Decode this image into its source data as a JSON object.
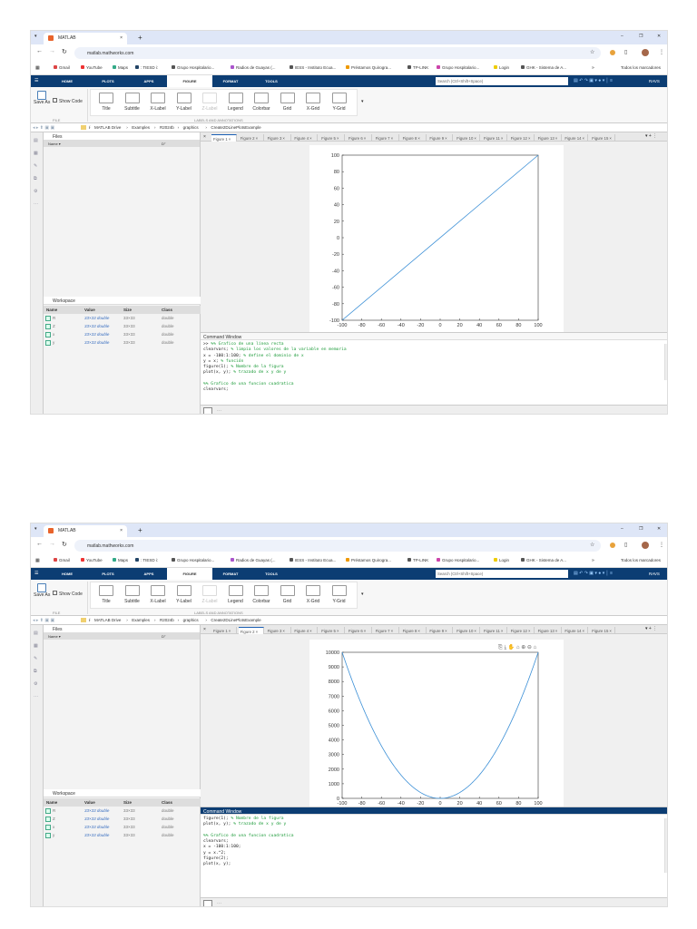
{
  "app": {
    "browser_tab": "MATLAB",
    "url": "matlab.mathworks.com",
    "bookmarks": [
      "Gmail",
      "YouTube",
      "Maps",
      ": TIESD i:",
      "Grupo Hospitalario...",
      "Radios de Guayas (...",
      "IESS - Instituto Ecua...",
      "Préstamos Quirogra...",
      "TP-LINK",
      "Grupo Hospitalario...",
      "Login",
      "GHK - Sistema de A..."
    ],
    "bookmarks_more": "»",
    "all_bookmarks": "Todos los marcadores",
    "toolstrip_tabs": [
      "HOME",
      "PLOTS",
      "APPS",
      "FIGURE",
      "FORMAT",
      "TOOLS"
    ],
    "search_placeholder": "Search (Ctrl+Shift+Space)",
    "user": "RAVS",
    "ribbon": {
      "save_as": "Save As",
      "show_code": "Show Code",
      "file_group": "FILE",
      "buttons": [
        "Title",
        "Subtitle",
        "X-Label",
        "Y-Label",
        "Z-Label",
        "Legend",
        "Colorbar",
        "Grid",
        "X-Grid",
        "Y-Grid"
      ],
      "labels_group": "LABELS AND ANNOTATIONS"
    },
    "path": [
      "/",
      "MATLAB Drive",
      "Examples",
      "R2024b",
      "graphics",
      "Create2DLinePlotsExample"
    ],
    "files": {
      "title": "Files",
      "col_name": "Name ▾",
      "col_date": "D°"
    },
    "workspace": {
      "title": "Workspace",
      "cols": [
        "Name",
        "Value",
        "Size",
        "Class"
      ],
      "rows": [
        [
          "R",
          "33×33 double",
          "33×33",
          "double"
        ],
        [
          "Z",
          "33×33 double",
          "33×33",
          "double"
        ],
        [
          "x",
          "33×33 double",
          "33×33",
          "double"
        ],
        [
          "y",
          "33×33 double",
          "33×33",
          "double"
        ]
      ]
    },
    "figure_tabs": [
      "Figure 1",
      "Figure 2",
      "Figure 3",
      "Figure 4",
      "Figure 5",
      "Figure 6",
      "Figure 7",
      "Figure 8",
      "Figure 9",
      "Figure 10",
      "Figure 11",
      "Figure 12",
      "Figure 13",
      "Figure 14",
      "Figure 15"
    ],
    "command_window": "Command Window",
    "prompt_more": "···",
    "colors": {
      "toolstrip": "#0c3d73",
      "line": "#3b8fd6",
      "comment": "#1d9b3a"
    }
  },
  "screenshots": [
    {
      "active_figure": 0,
      "command_active": false,
      "command_lines": [
        {
          "code": ">> ",
          "comment": "%% Grafico de una línea recta"
        },
        {
          "code": "clearvars; ",
          "comment": "% limpia los valores de la variable en memoria"
        },
        {
          "code": "x = -100:1:100; ",
          "comment": "% define el dominio de x"
        },
        {
          "code": "y = x; ",
          "comment": "% función"
        },
        {
          "code": "figure(1); ",
          "comment": "% Nombre de la figura"
        },
        {
          "code": "plot(x, y); ",
          "comment": "% trazado de x y de y"
        },
        {
          "code": "",
          "comment": ""
        },
        {
          "code": "",
          "comment": "%% Grafico de una funcion cuadratica"
        },
        {
          "code": "clearvars;",
          "comment": ""
        }
      ]
    },
    {
      "active_figure": 1,
      "command_active": true,
      "command_lines": [
        {
          "code": "figure(1); ",
          "comment": "% Nombre de la figura"
        },
        {
          "code": "plot(x, y); ",
          "comment": "% trazado de x y de y"
        },
        {
          "code": "",
          "comment": ""
        },
        {
          "code": "",
          "comment": "%% Grafico de una funcion cuadratica"
        },
        {
          "code": "clearvars;",
          "comment": ""
        },
        {
          "code": "x = -100:1:100;",
          "comment": ""
        },
        {
          "code": "y = x.^2;",
          "comment": ""
        },
        {
          "code": "figure(2);",
          "comment": ""
        },
        {
          "code": "plot(x, y);",
          "comment": ""
        }
      ]
    }
  ],
  "chart_data": [
    {
      "type": "line",
      "title": "",
      "xlabel": "",
      "ylabel": "",
      "xlim": [
        -100,
        100
      ],
      "ylim": [
        -100,
        100
      ],
      "xticks": [
        -100,
        -80,
        -60,
        -40,
        -20,
        0,
        20,
        40,
        60,
        80,
        100
      ],
      "yticks": [
        -100,
        -80,
        -60,
        -40,
        -20,
        0,
        20,
        40,
        60,
        80,
        100
      ],
      "series": [
        {
          "name": "y = x",
          "x": [
            -100,
            100
          ],
          "y": [
            -100,
            100
          ]
        }
      ],
      "grid": false
    },
    {
      "type": "line",
      "title": "",
      "xlabel": "",
      "ylabel": "",
      "xlim": [
        -100,
        100
      ],
      "ylim": [
        0,
        10000
      ],
      "xticks": [
        -100,
        -80,
        -60,
        -40,
        -20,
        0,
        20,
        40,
        60,
        80,
        100
      ],
      "yticks": [
        0,
        1000,
        2000,
        3000,
        4000,
        5000,
        6000,
        7000,
        8000,
        9000,
        10000
      ],
      "series": [
        {
          "name": "y = x.^2",
          "formula": "x.^2",
          "x_range": [
            -100,
            100
          ],
          "step": 1
        }
      ],
      "grid": false
    }
  ]
}
